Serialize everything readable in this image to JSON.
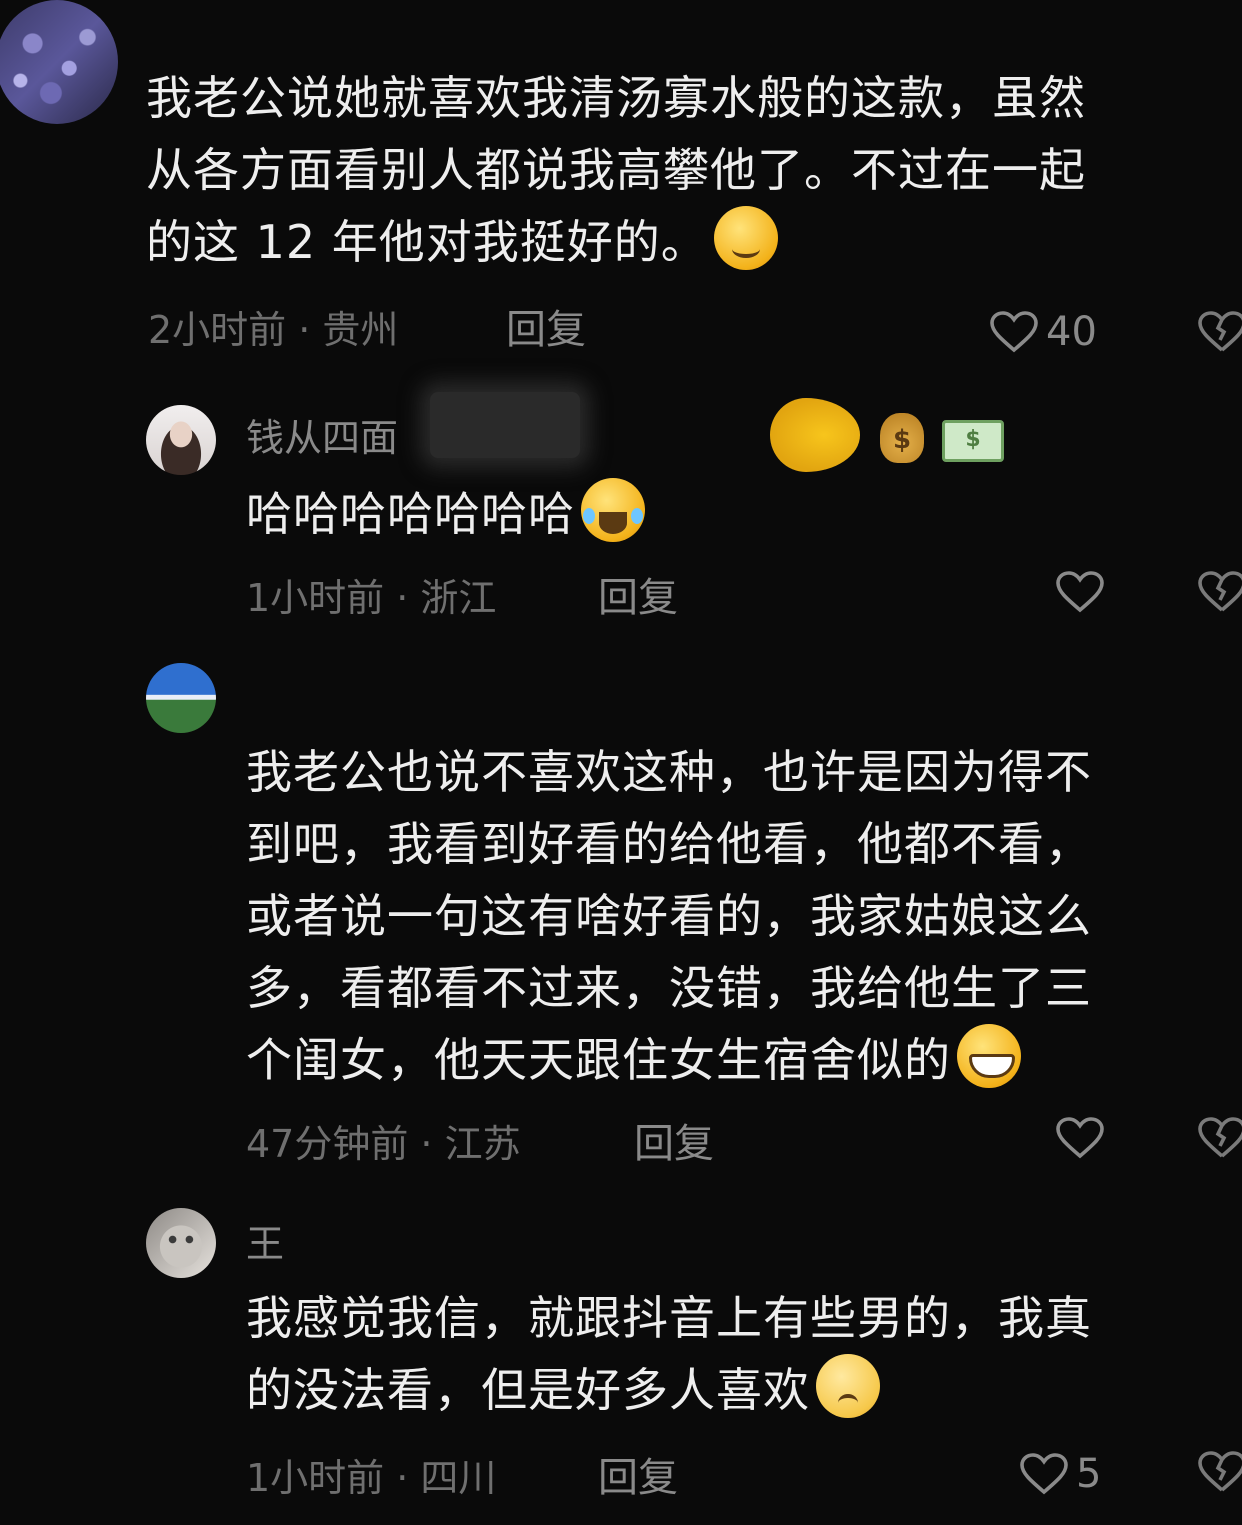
{
  "comments": [
    {
      "text_lines": [
        "我老公说她就喜欢我清汤寡水般的这款，虽然",
        "从各方面看别人都说我高攀他了。不过在一起",
        "的这 12 年他对我挺好的。"
      ],
      "emoji": "smiling-face-icon",
      "meta": "2小时前 · 贵州",
      "reply": "回复",
      "likes": "40"
    },
    {
      "username": "钱从四面",
      "text_lines": [
        "哈哈哈哈哈哈哈"
      ],
      "emoji": "tears-of-joy-icon",
      "meta": "1小时前 · 浙江",
      "reply": "回复",
      "likes": ""
    },
    {
      "text_lines": [
        "我老公也说不喜欢这种，也许是因为得不",
        "到吧，我看到好看的给他看，他都不看，",
        "或者说一句这有啥好看的，我家姑娘这么",
        "多，看都看不过来，没错，我给他生了三",
        "个闺女，他天天跟住女生宿舍似的"
      ],
      "emoji": "grinning-face-icon",
      "meta": "47分钟前 · 江苏",
      "reply": "回复",
      "likes": ""
    },
    {
      "username": "王",
      "text_lines": [
        "我感觉我信，就跟抖音上有些男的，我真",
        "的没法看，但是好多人喜欢"
      ],
      "emoji": "pleading-face-icon",
      "meta": "1小时前 · 四川",
      "reply": "回复",
      "likes": "5"
    }
  ],
  "badges": {
    "money_bag": "$",
    "money_bill": "$"
  }
}
